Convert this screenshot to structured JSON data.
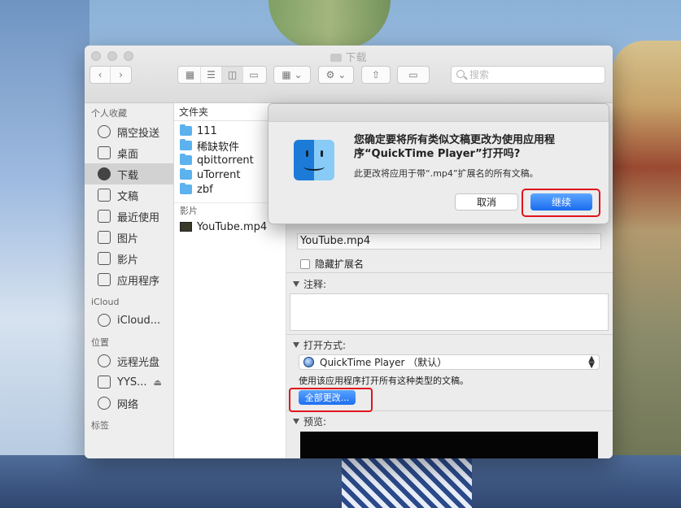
{
  "window": {
    "title": "下载"
  },
  "search": {
    "placeholder": "搜索"
  },
  "sidebar": {
    "favorites_heading": "个人收藏",
    "favorites": [
      {
        "label": "隔空投送",
        "icon": "airdrop-icon"
      },
      {
        "label": "桌面",
        "icon": "desktop-icon"
      },
      {
        "label": "下载",
        "icon": "downloads-icon",
        "selected": true
      },
      {
        "label": "文稿",
        "icon": "documents-icon"
      },
      {
        "label": "最近使用",
        "icon": "recents-icon"
      },
      {
        "label": "图片",
        "icon": "pictures-icon"
      },
      {
        "label": "影片",
        "icon": "movies-icon"
      },
      {
        "label": "应用程序",
        "icon": "applications-icon"
      }
    ],
    "icloud_heading": "iCloud",
    "icloud": [
      {
        "label": "iCloud...",
        "icon": "cloud-icon"
      }
    ],
    "locations_heading": "位置",
    "locations": [
      {
        "label": "远程光盘",
        "icon": "disc-icon"
      },
      {
        "label": "YYS...",
        "icon": "drive-icon",
        "eject": "⏏"
      },
      {
        "label": "网络",
        "icon": "network-icon"
      }
    ],
    "tags_heading": "标签"
  },
  "file_list": {
    "folder_heading": "文件夹",
    "folders": [
      "111",
      "稀缺软件",
      "qbittorrent",
      "uTorrent",
      "zbf"
    ],
    "movies_heading": "影片",
    "movies": [
      "YouTube.mp4"
    ]
  },
  "info_panel": {
    "filename": "YouTube.mp4",
    "hide_extension_label": "隐藏扩展名",
    "comments_heading": "注释:",
    "open_with_heading": "打开方式:",
    "app_name": "QuickTime Player （默认）",
    "help_text": "使用该应用程序打开所有这种类型的文稿。",
    "change_all_label": "全部更改...",
    "preview_heading": "预览:"
  },
  "dialog": {
    "title": "您确定要将所有类似文稿更改为使用应用程序“QuickTime Player”打开吗?",
    "message": "此更改将应用于带“.mp4”扩展名的所有文稿。",
    "cancel_label": "取消",
    "continue_label": "继续"
  }
}
